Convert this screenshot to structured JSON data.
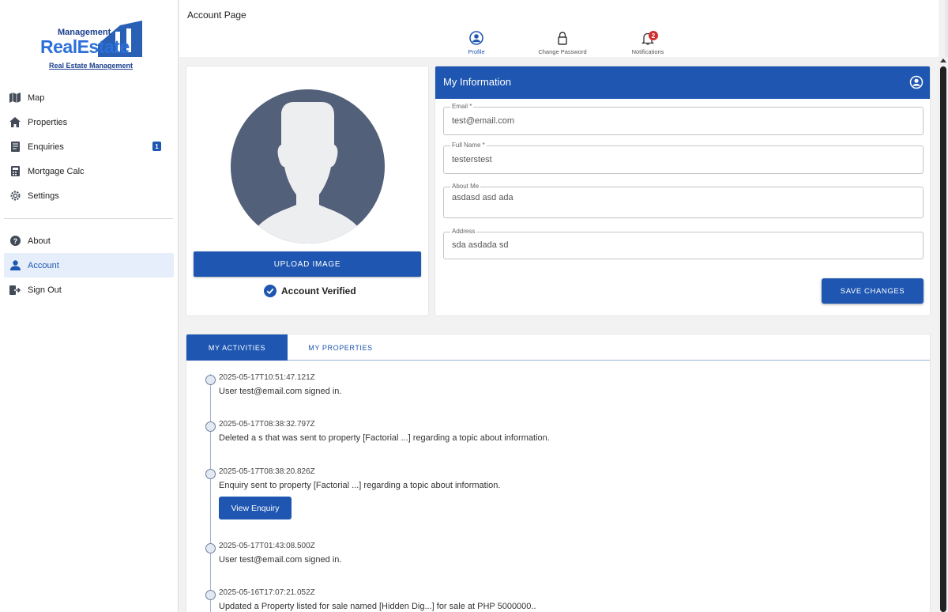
{
  "brand": {
    "management": "Management",
    "name": "RealEstate",
    "subtitle": "Real Estate Management"
  },
  "sidebar": {
    "items": [
      {
        "label": "Map",
        "icon": "map-icon"
      },
      {
        "label": "Properties",
        "icon": "home-icon"
      },
      {
        "label": "Enquiries",
        "icon": "document-icon",
        "badge": "1"
      },
      {
        "label": "Mortgage Calc",
        "icon": "calculator-icon"
      },
      {
        "label": "Settings",
        "icon": "gear-icon"
      }
    ],
    "secondary": [
      {
        "label": "About",
        "icon": "help-icon"
      },
      {
        "label": "Account",
        "icon": "person-icon",
        "active": true
      },
      {
        "label": "Sign Out",
        "icon": "logout-icon"
      }
    ]
  },
  "header": {
    "title": "Account Page",
    "tabs": [
      {
        "label": "Profile",
        "icon": "account-circle-icon",
        "active": true
      },
      {
        "label": "Change Password",
        "icon": "lock-icon"
      },
      {
        "label": "Notifications",
        "icon": "bell-icon",
        "badge": "2"
      }
    ]
  },
  "profile": {
    "upload_label": "UPLOAD IMAGE",
    "verified_label": "Account Verified"
  },
  "info": {
    "title": "My Information",
    "fields": [
      {
        "label": "Email *",
        "value": "test@email.com"
      },
      {
        "label": "Full Name *",
        "value": "testerstest"
      },
      {
        "label": "About Me",
        "value": "asdasd asd ada"
      },
      {
        "label": "Address",
        "value": "sda asdada sd"
      }
    ],
    "save_label": "SAVE CHANGES"
  },
  "activity": {
    "tabs": [
      "MY ACTIVITIES",
      "MY PROPERTIES"
    ],
    "entries": [
      {
        "timestamp": "2025-05-17T10:51:47.121Z",
        "message": "User test@email.com signed in."
      },
      {
        "timestamp": "2025-05-17T08:38:32.797Z",
        "message": "Deleted a s that was sent to property [Factorial ...] regarding a topic about information."
      },
      {
        "timestamp": "2025-05-17T08:38:20.826Z",
        "message": "Enquiry sent to property [Factorial ...] regarding a topic about information.",
        "action": "View Enquiry"
      },
      {
        "timestamp": "2025-05-17T01:43:08.500Z",
        "message": "User test@email.com signed in."
      },
      {
        "timestamp": "2025-05-16T17:07:21.052Z",
        "message": "Updated a Property listed for sale named [Hidden Dig...] for sale at PHP 5000000.."
      }
    ]
  },
  "colors": {
    "primary": "#1e56b1",
    "avatar_bg": "#53607a",
    "badge_red": "#d32f2f"
  }
}
